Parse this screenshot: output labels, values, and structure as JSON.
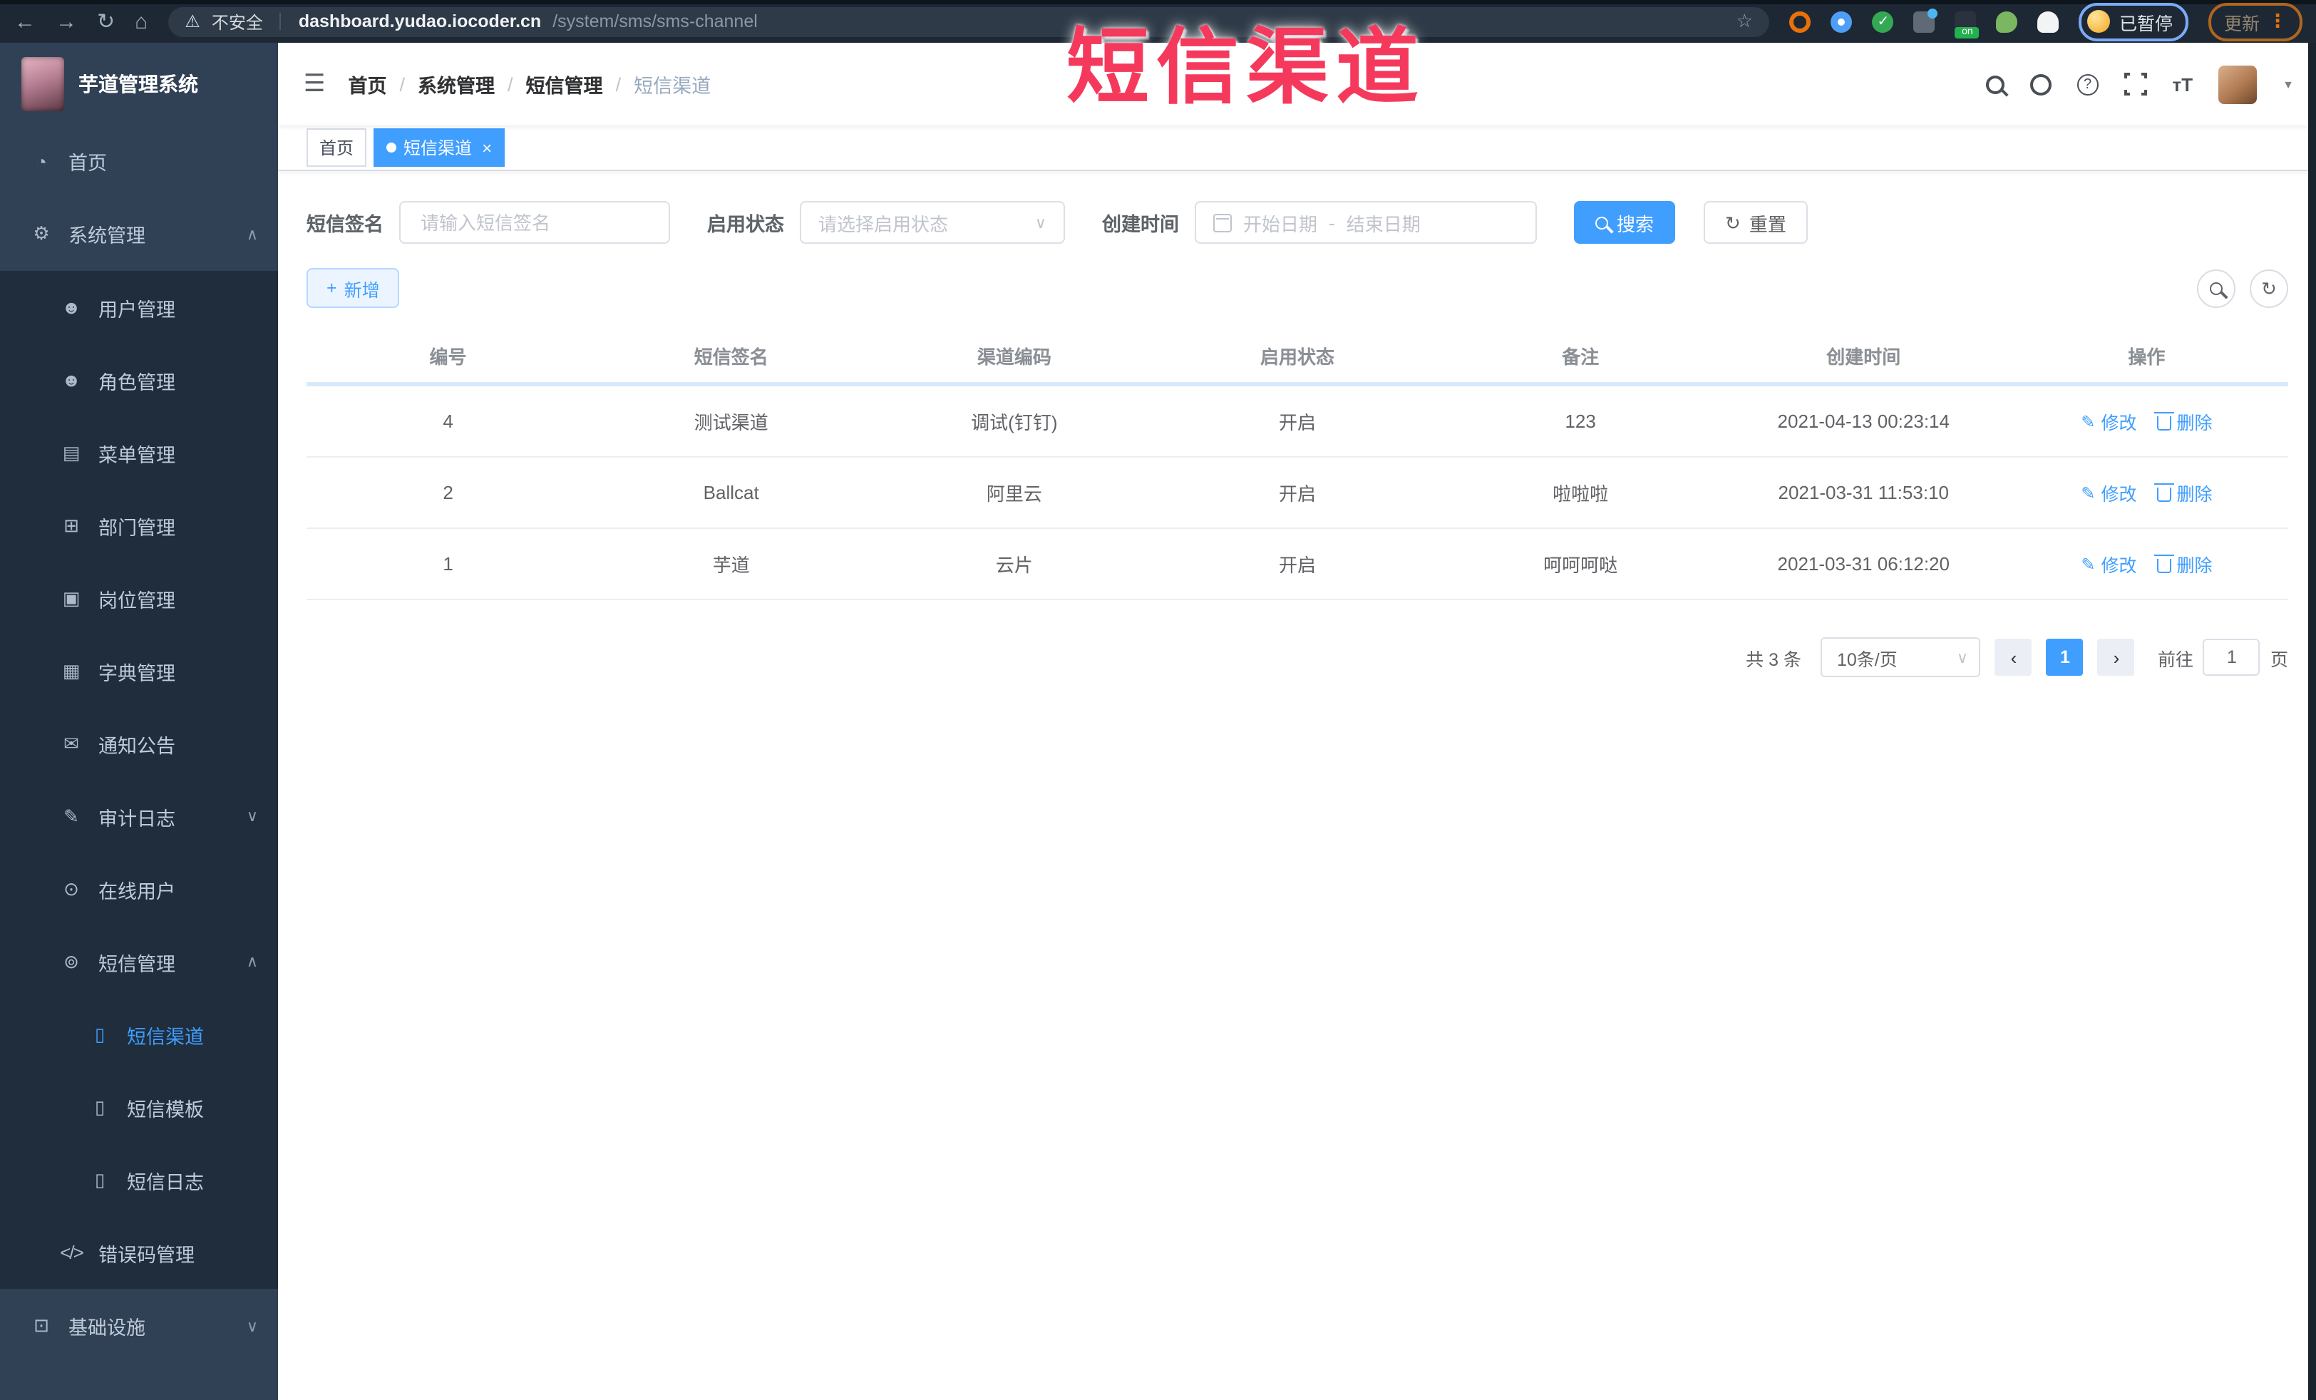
{
  "browser": {
    "security_label": "不安全",
    "url_domain": "dashboard.yudao.iocoder.cn",
    "url_path": "/system/sms/sms-channel",
    "extension_on_badge": "on",
    "paused_badge": "已暂停",
    "update_label": "更新"
  },
  "annotation": {
    "text": "短信渠道",
    "color": "#f5395c"
  },
  "sidebar": {
    "logo_title": "芋道管理系统",
    "items": [
      "首页",
      "系统管理",
      "用户管理",
      "角色管理",
      "菜单管理",
      "部门管理",
      "岗位管理",
      "字典管理",
      "通知公告",
      "审计日志",
      "在线用户",
      "短信管理",
      "短信渠道",
      "短信模板",
      "短信日志",
      "错误码管理",
      "基础设施"
    ]
  },
  "navbar": {
    "breadcrumb": [
      "首页",
      "系统管理",
      "短信管理",
      "短信渠道"
    ],
    "separator": "/"
  },
  "tabs": [
    {
      "label": "首页",
      "active": false
    },
    {
      "label": "短信渠道",
      "active": true
    }
  ],
  "filters": {
    "sign_label": "短信签名",
    "sign_placeholder": "请输入短信签名",
    "status_label": "启用状态",
    "status_placeholder": "请选择启用状态",
    "time_label": "创建时间",
    "date_start_placeholder": "开始日期",
    "date_separator": "-",
    "date_end_placeholder": "结束日期",
    "search_label": "搜索",
    "reset_label": "重置"
  },
  "toolbar": {
    "add_label": "新增"
  },
  "table": {
    "headers": [
      "编号",
      "短信签名",
      "渠道编码",
      "启用状态",
      "备注",
      "创建时间",
      "操作"
    ],
    "rows": [
      [
        "4",
        "测试渠道",
        "调试(钉钉)",
        "开启",
        "123",
        "2021-04-13 00:23:14"
      ],
      [
        "2",
        "Ballcat",
        "阿里云",
        "开启",
        "啦啦啦",
        "2021-03-31 11:53:10"
      ],
      [
        "1",
        "芋道",
        "云片",
        "开启",
        "呵呵呵哒",
        "2021-03-31 06:12:20"
      ]
    ],
    "edit_label": "修改",
    "delete_label": "删除"
  },
  "pagination": {
    "total": "共 3 条",
    "page_size": "10条/页",
    "current_page": "1",
    "jump_prefix": "前往",
    "jump_value": "1",
    "jump_suffix": "页"
  },
  "colors": {
    "accent": "#409eff",
    "sidebar_bg": "#304156",
    "submenu_bg": "#1f2d3d",
    "annotation_red": "#f5395c"
  },
  "icons": {
    "back": "←",
    "forward": "→",
    "reload": "↻",
    "home": "⌂",
    "warning": "⚠",
    "star": "☆",
    "menu_dots": "⋮",
    "hamburger": "☰",
    "caret_down": "▼",
    "dashboard": "◔",
    "gear": "⚙",
    "user": "☻",
    "roles": "☻",
    "menu_list": "▤",
    "org": "⊞",
    "post": "▣",
    "dict": "▦",
    "notice": "✉",
    "audit": "✎",
    "online": "⊙",
    "sms": "⊚",
    "phone": "▯",
    "code": "</>",
    "infra": "⊡",
    "chevron_up": "∧",
    "chevron_down": "∨",
    "check": "✓",
    "refresh": "↻",
    "plus": "+",
    "edit": "✎",
    "prev": "‹",
    "next": "›",
    "close": "×"
  }
}
